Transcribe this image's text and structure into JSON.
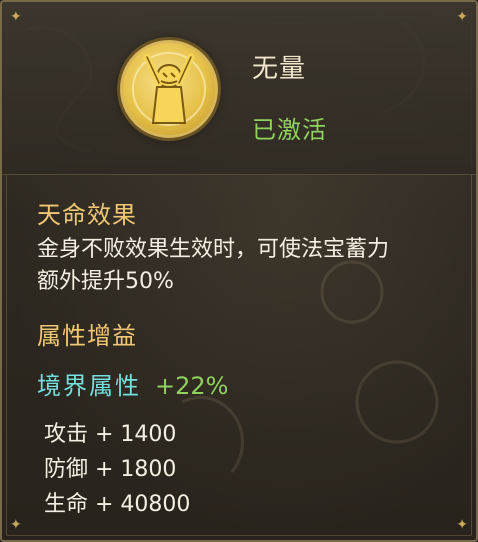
{
  "item": {
    "name": "无量",
    "status": "已激活",
    "icon": "golden-figure-medal"
  },
  "fate_effect": {
    "heading": "天命效果",
    "description_line1": "金身不败效果生效时，可使法宝蓄力",
    "description_line2": "额外提升50%"
  },
  "attribute_bonus": {
    "heading": "属性增益",
    "realm_label": "境界属性",
    "realm_value": "+22%",
    "stats": [
      {
        "text": "攻击 + 1400"
      },
      {
        "text": "防御 + 1800"
      },
      {
        "text": "生命 + 40800"
      }
    ]
  },
  "colors": {
    "title": "#f1e7cc",
    "active_green": "#8fd35e",
    "heading_gold": "#f0c874",
    "realm_cyan": "#74e0df",
    "body_text": "#f4efe2",
    "panel_bg": "#2d2821",
    "border": "#7a6a4c"
  }
}
